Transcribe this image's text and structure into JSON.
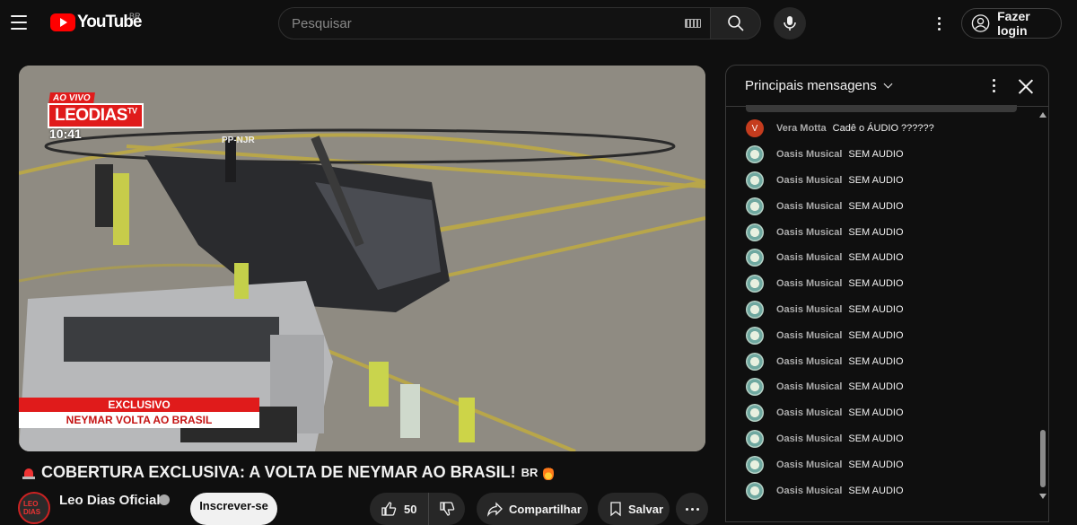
{
  "header": {
    "logo_text": "YouTube",
    "country_code": "BR",
    "search_placeholder": "Pesquisar",
    "login_label": "Fazer login"
  },
  "video": {
    "overlay": {
      "live_tag": "AO VIVO",
      "brand": "LEODIAS",
      "brand_suffix": "TV",
      "clock": "10:41",
      "lower_third_top": "EXCLUSIVO",
      "lower_third_bottom": "NEYMAR VOLTA AO BRASIL",
      "heli_registration": "PP-NJR"
    },
    "title": "COBERTURA EXCLUSIVA: A VOLTA DE NEYMAR AO BRASIL!",
    "title_tag": "BR",
    "channel": {
      "name": "Leo Dias Oficial",
      "avatar_text": "LEO DIAS",
      "subscribe_label": "Inscrever-se"
    },
    "actions": {
      "likes": "50",
      "share_label": "Compartilhar",
      "save_label": "Salvar"
    }
  },
  "chat": {
    "mode_label": "Principais mensagens",
    "messages": [
      {
        "author": "Vera Motta",
        "text": "Cadê o ÁUDIO ??????",
        "avatar": "V"
      },
      {
        "author": "Oasis Musical",
        "text": "SEM AUDIO"
      },
      {
        "author": "Oasis Musical",
        "text": "SEM AUDIO"
      },
      {
        "author": "Oasis Musical",
        "text": "SEM AUDIO"
      },
      {
        "author": "Oasis Musical",
        "text": "SEM AUDIO"
      },
      {
        "author": "Oasis Musical",
        "text": "SEM AUDIO"
      },
      {
        "author": "Oasis Musical",
        "text": "SEM AUDIO"
      },
      {
        "author": "Oasis Musical",
        "text": "SEM AUDIO"
      },
      {
        "author": "Oasis Musical",
        "text": "SEM AUDIO"
      },
      {
        "author": "Oasis Musical",
        "text": "SEM AUDIO"
      },
      {
        "author": "Oasis Musical",
        "text": "SEM AUDIO"
      },
      {
        "author": "Oasis Musical",
        "text": "SEM AUDIO"
      },
      {
        "author": "Oasis Musical",
        "text": "SEM AUDIO"
      },
      {
        "author": "Oasis Musical",
        "text": "SEM AUDIO"
      },
      {
        "author": "Oasis Musical",
        "text": "SEM AUDIO"
      }
    ]
  }
}
